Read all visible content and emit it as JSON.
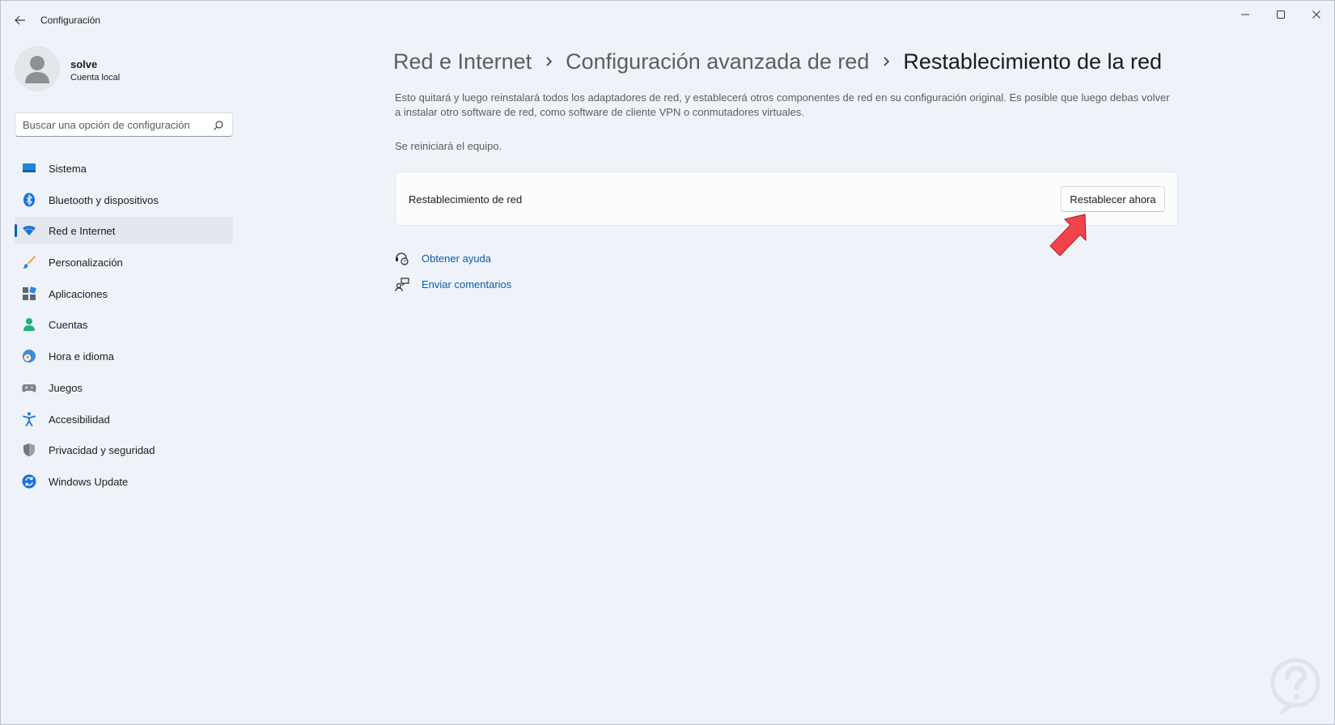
{
  "window": {
    "title": "Configuración"
  },
  "user": {
    "name": "solve",
    "account_type": "Cuenta local"
  },
  "search": {
    "placeholder": "Buscar una opción de configuración"
  },
  "sidebar": {
    "items": [
      {
        "label": "Sistema",
        "icon": "monitor-icon"
      },
      {
        "label": "Bluetooth y dispositivos",
        "icon": "bluetooth-icon"
      },
      {
        "label": "Red e Internet",
        "icon": "wifi-icon",
        "active": true
      },
      {
        "label": "Personalización",
        "icon": "brush-icon"
      },
      {
        "label": "Aplicaciones",
        "icon": "apps-icon"
      },
      {
        "label": "Cuentas",
        "icon": "person-icon"
      },
      {
        "label": "Hora e idioma",
        "icon": "globe-clock-icon"
      },
      {
        "label": "Juegos",
        "icon": "gamepad-icon"
      },
      {
        "label": "Accesibilidad",
        "icon": "accessibility-icon"
      },
      {
        "label": "Privacidad y seguridad",
        "icon": "shield-icon"
      },
      {
        "label": "Windows Update",
        "icon": "update-icon"
      }
    ]
  },
  "breadcrumb": {
    "level1": "Red e Internet",
    "level2": "Configuración avanzada de red",
    "current": "Restablecimiento de la red"
  },
  "main": {
    "description": "Esto quitará y luego reinstalará todos los adaptadores de red, y establecerá otros componentes de red en su configuración original. Es posible que luego debas volver a instalar otro software de red, como software de cliente VPN o conmutadores virtuales.",
    "restart_note": "Se reiniciará el equipo.",
    "card": {
      "label": "Restablecimiento de red",
      "button": "Restablecer ahora"
    },
    "links": {
      "help": "Obtener ayuda",
      "feedback": "Enviar comentarios"
    }
  },
  "colors": {
    "accent": "#005fb8",
    "link": "#0b5cad",
    "arrow": "#f2424a",
    "background": "#eff3f9"
  }
}
